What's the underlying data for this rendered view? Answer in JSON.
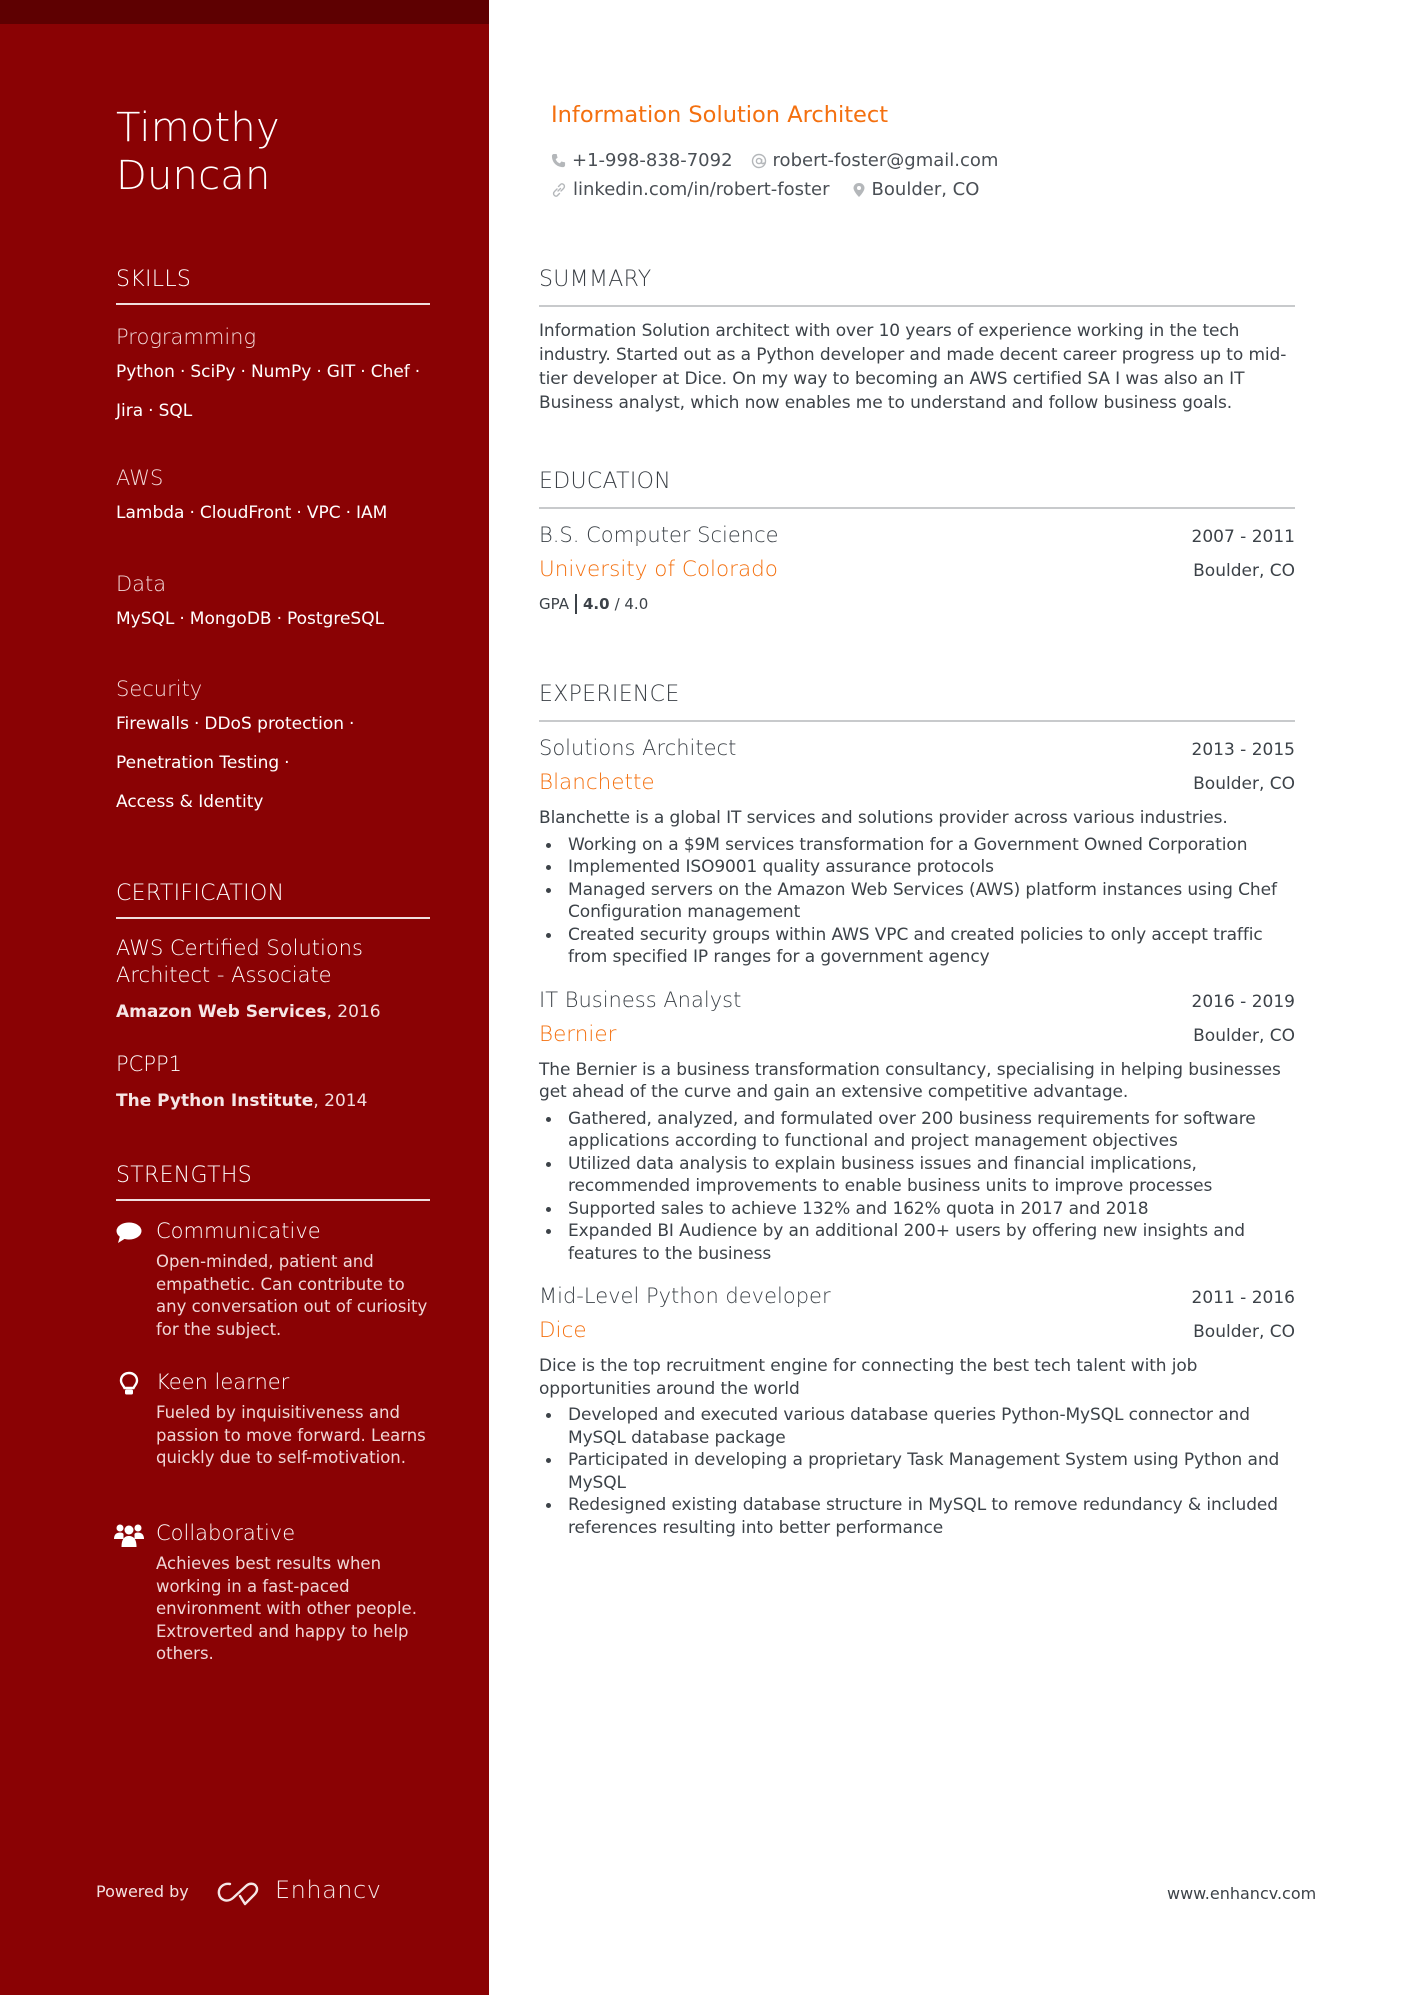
{
  "profile": {
    "first_name": "Timothy",
    "last_name": "Duncan",
    "title": "Information Solution Architect",
    "contact": {
      "phone": "+1-998-838-7092",
      "email": "robert-foster@gmail.com",
      "linkedin": "linkedin.com/in/robert-foster",
      "location": "Boulder, CO"
    }
  },
  "colors": {
    "sidebar": "#8a0204",
    "sidebar_top": "#5e0001",
    "accent": "#f4700f",
    "text": "#3c4248"
  },
  "sidebar": {
    "skills": {
      "heading": "SKILLS",
      "groups": [
        {
          "title": "Programming",
          "lines": [
            [
              "Python",
              "SciPy",
              "NumPy",
              "GIT",
              "Chef"
            ],
            [
              "Jira",
              "SQL"
            ]
          ]
        },
        {
          "title": "AWS",
          "lines": [
            [
              "Lambda",
              "CloudFront",
              "VPC",
              "IAM"
            ]
          ]
        },
        {
          "title": "Data",
          "lines": [
            [
              "MySQL",
              "MongoDB",
              "PostgreSQL"
            ]
          ]
        },
        {
          "title": "Security",
          "lines": [
            [
              "Firewalls",
              "DDoS protection"
            ],
            [
              "Penetration Testing"
            ],
            [
              "Access & Identity"
            ]
          ]
        }
      ]
    },
    "certification": {
      "heading": "CERTIFICATION",
      "items": [
        {
          "title_line1": "AWS Certified Solutions",
          "title_line2": "Architect - Associate",
          "issuer": "Amazon Web Services",
          "year": ", 2016"
        },
        {
          "title_line1": "PCPP1",
          "title_line2": "",
          "issuer": "The Python Institute",
          "year": ", 2014"
        }
      ]
    },
    "strengths": {
      "heading": "STRENGTHS",
      "items": [
        {
          "icon": "speech-bubble-icon",
          "title": "Communicative",
          "description": "Open-minded, patient and empathetic. Can contribute to any conversation out of curiosity for the subject."
        },
        {
          "icon": "lightbulb-icon",
          "title": "Keen learner",
          "description": "Fueled by inquisitiveness and passion to move forward. Learns quickly due to self-motivation."
        },
        {
          "icon": "users-icon",
          "title": "Collaborative",
          "description": "Achieves best results when working in a fast-paced environment with other people. Extroverted and happy to help others."
        }
      ]
    },
    "footer": {
      "powered_by": "Powered by",
      "brand": "Enhancv"
    }
  },
  "summary": {
    "heading": "SUMMARY",
    "text": "Information Solution architect with over 10 years of experience working in the tech industry. Started out as a Python developer and made decent career progress up to mid-tier developer at Dice. On my way to becoming an AWS certified SA I was also an IT Business analyst, which now enables me to understand and follow business goals."
  },
  "education": {
    "heading": "EDUCATION",
    "items": [
      {
        "degree": "B.S. Computer Science",
        "dates": "2007 - 2011",
        "school": "University of Colorado",
        "location": "Boulder, CO",
        "gpa_label": "GPA",
        "gpa_value": "4.0",
        "gpa_max": "/ 4.0"
      }
    ]
  },
  "experience": {
    "heading": "EXPERIENCE",
    "items": [
      {
        "role": "Solutions Architect",
        "dates": "2013 - 2015",
        "company": "Blanchette",
        "location": "Boulder, CO",
        "description": "Blanchette is a global IT services and solutions provider across various industries.",
        "bullets": [
          "Working on a $9M services transformation for a Government Owned Corporation",
          "Implemented ISO9001 quality assurance protocols",
          "Managed servers on the Amazon Web Services (AWS) platform instances using Chef Configuration management",
          "Created security groups within AWS VPC and created policies to only accept traffic from specified IP ranges for a government agency"
        ]
      },
      {
        "role": "IT Business Analyst",
        "dates": "2016 - 2019",
        "company": "Bernier",
        "location": "Boulder, CO",
        "description": "The Bernier is a business transformation consultancy, specialising in helping businesses get ahead of the curve and gain an extensive competitive advantage.",
        "bullets": [
          "Gathered, analyzed, and formulated over 200 business requirements for software applications according to functional and project management objectives",
          "Utilized data analysis to explain business issues and financial implications, recommended improvements to enable business units to improve processes",
          "Supported sales to achieve 132% and 162% quota in 2017 and 2018",
          "Expanded BI Audience by an additional 200+ users by offering new insights and features to the business"
        ]
      },
      {
        "role": "Mid-Level Python developer",
        "dates": "2011 - 2016",
        "company": "Dice",
        "location": "Boulder, CO",
        "description": "Dice is the top recruitment engine for connecting the best tech talent with job opportunities around the world",
        "bullets": [
          "Developed and executed various database queries Python-MySQL connector and MySQL database package",
          "Participated in developing a proprietary Task Management System using Python and MySQL",
          "Redesigned existing database structure in MySQL to remove redundancy & included references resulting into better performance"
        ]
      }
    ]
  },
  "footer": {
    "url": "www.enhancv.com"
  }
}
